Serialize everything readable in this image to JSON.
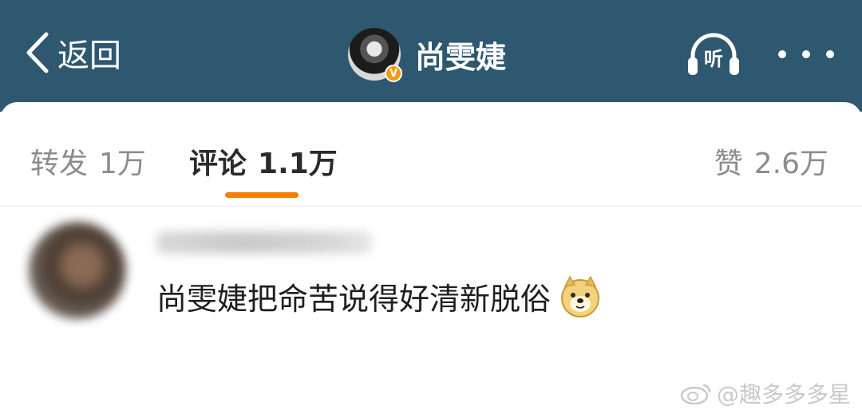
{
  "header": {
    "back_label": "返回",
    "username": "尚雯婕",
    "verified_badge": "V",
    "listen_label": "听"
  },
  "tabs": {
    "repost_label": "转发",
    "repost_count": "1万",
    "comment_label": "评论",
    "comment_count": "1.1万",
    "like_label": "赞",
    "like_count": "2.6万"
  },
  "comment": {
    "text": "尚雯婕把命苦说得好清新脱俗",
    "emoji": "doge-emoji"
  },
  "watermark": {
    "text": "@趣多多多星"
  },
  "colors": {
    "header_bg": "#2e5870",
    "accent": "#f77f00",
    "verified": "#f39c12"
  }
}
